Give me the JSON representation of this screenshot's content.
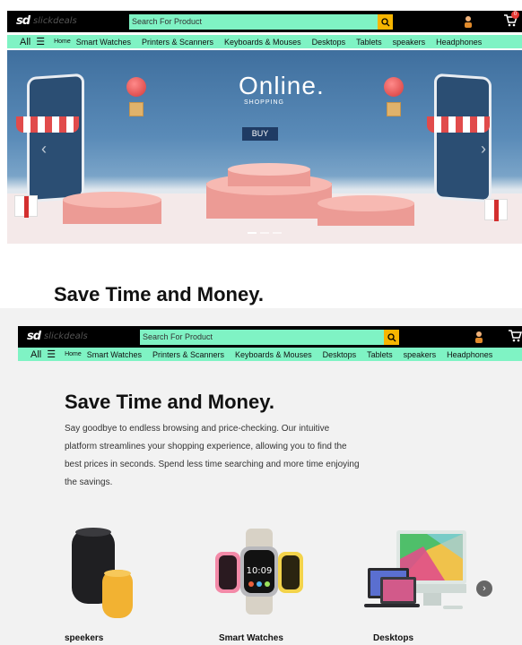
{
  "header": {
    "logo_mark": "sd",
    "logo_text": "slickdeals",
    "search_placeholder": "Search For Product",
    "cart_count": "0"
  },
  "nav": {
    "all_label": "All",
    "items": [
      "Home",
      "Smart Watches",
      "Printers & Scanners",
      "Keyboards & Mouses",
      "Desktops",
      "Tablets",
      "speakers",
      "Headphones"
    ]
  },
  "banner": {
    "title": "Online.",
    "subtitle": "SHOPPING",
    "button": "BUY"
  },
  "section_title": "Save Time and Money.",
  "hero": {
    "title": "Save Time and Money.",
    "text": "Say goodbye to endless browsing and price-checking. Our intuitive platform streamlines your shopping experience, allowing you to find the best prices in seconds. Spend less time searching and more time enjoying the savings."
  },
  "products": [
    {
      "label": "speekers",
      "icon": "smart-speaker"
    },
    {
      "label": "Smart Watches",
      "icon": "smartwatch"
    },
    {
      "label": "Desktops",
      "icon": "desktop-computer"
    }
  ],
  "colors": {
    "header_bg": "#000000",
    "accent_mint": "#7ff3c4",
    "search_button": "#f7b500",
    "badge": "#e53935"
  }
}
